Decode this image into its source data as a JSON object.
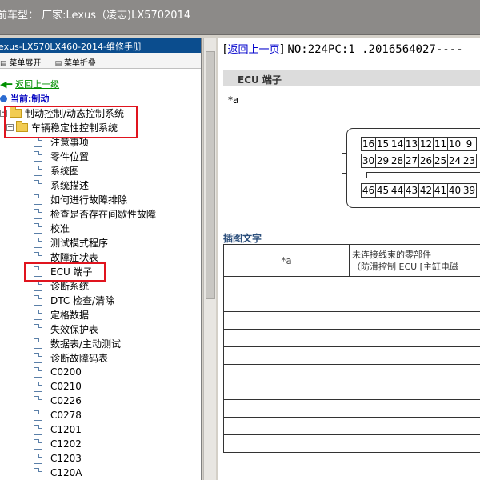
{
  "window": {
    "title": "前车型：  厂家:Lexus（凌志)LX5702014"
  },
  "left_panel": {
    "header": "exus-LX570LX460-2014-维修手册",
    "menu": {
      "expand_label": "菜单展开",
      "collapse_label": "菜单折叠"
    },
    "back_link": "返回上一级",
    "current_label": "当前:制动",
    "folders": [
      {
        "label": "制动控制/动态控制系统"
      },
      {
        "label": "车辆稳定性控制系统"
      }
    ],
    "items": [
      {
        "label": "注意事项"
      },
      {
        "label": "零件位置"
      },
      {
        "label": "系统图"
      },
      {
        "label": "系统描述"
      },
      {
        "label": "如何进行故障排除"
      },
      {
        "label": "检查是否存在间歇性故障"
      },
      {
        "label": "校准"
      },
      {
        "label": "测试模式程序"
      },
      {
        "label": "故障症状表"
      },
      {
        "label": "ECU 端子"
      },
      {
        "label": "诊断系统"
      },
      {
        "label": "DTC 检查/清除"
      },
      {
        "label": "定格数据"
      },
      {
        "label": "失效保护表"
      },
      {
        "label": "数据表/主动测试"
      },
      {
        "label": "诊断故障码表"
      },
      {
        "label": "C0200"
      },
      {
        "label": "C0210"
      },
      {
        "label": "C0226"
      },
      {
        "label": "C0278"
      },
      {
        "label": "C1201"
      },
      {
        "label": "C1202"
      },
      {
        "label": "C1203"
      },
      {
        "label": "C120A"
      }
    ],
    "selected_item": "ECU 端子"
  },
  "right_panel": {
    "back_link": "返回上一页",
    "doc_id": "NO:224PC:1 .2016564027----",
    "section_title": "ECU 端子",
    "label_a": "*a",
    "connector_pins": {
      "row1": [
        "16",
        "15",
        "14",
        "13",
        "12",
        "11",
        "10",
        "9"
      ],
      "row2": [
        "30",
        "29",
        "28",
        "27",
        "26",
        "25",
        "24",
        "23"
      ],
      "row3": [
        "46",
        "45",
        "44",
        "43",
        "42",
        "41",
        "40",
        "39"
      ]
    },
    "caption": "插图文字",
    "legend": {
      "key": "*a",
      "desc_line1": "未连接线束的零部件",
      "desc_line2": "（防滑控制 ECU [主缸电磁"
    }
  },
  "colors": {
    "title_bar": "#8c8a88",
    "left_header": "#0b4d8e",
    "highlight_box": "#e0141e",
    "link": "#0000cc",
    "back_link_green": "#009000"
  }
}
